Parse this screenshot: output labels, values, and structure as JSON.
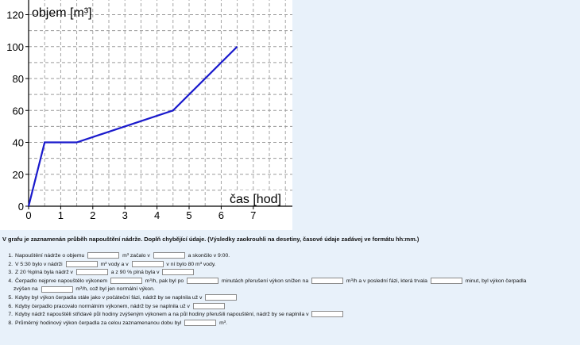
{
  "chart_data": {
    "type": "line",
    "xlabel": "čas [hod]",
    "ylabel": "objem [m³]",
    "x_ticks": [
      "0",
      "1",
      "2",
      "3",
      "4",
      "5",
      "6",
      "7"
    ],
    "y_ticks": [
      "0",
      "20",
      "40",
      "60",
      "80",
      "100",
      "120"
    ],
    "xlim": [
      0,
      8
    ],
    "ylim": [
      0,
      125
    ],
    "grid": true,
    "points": [
      [
        0,
        0
      ],
      [
        0.5,
        40
      ],
      [
        1.5,
        40
      ],
      [
        4.5,
        60
      ],
      [
        6.5,
        100
      ]
    ],
    "line_color": "#1a1acc"
  },
  "task": "V grafu je zaznamenán průběh napouštění nádrže. Doplň chybějící údaje. (Výsledky zaokrouhli na desetiny, časové údaje zadávej ve formátu hh:mm.)",
  "items": {
    "1": {
      "num": "1.",
      "a": "Napouštění nádrže o objemu",
      "b": "m³ začalo v",
      "c": "a skončilo v 9:00."
    },
    "2": {
      "num": "2.",
      "a": "V 5:30 bylo v nádrži",
      "b": "m³ vody a v",
      "c": "v ní bylo 80 m³ vody."
    },
    "3": {
      "num": "3.",
      "a": "Z 20 %plná byla nádrž v",
      "b": "a z 90 % plná byla v"
    },
    "4": {
      "num": "4.",
      "a": "Čerpadlo nejprve napouštělo výkonem",
      "b": "m³/h, pak byl po",
      "c": "minutách přerušení výkon snížen na",
      "d": "m³/h a v poslední fázi, která trvala",
      "e": "minut, byl výkon čerpadla",
      "f": "zvýšen na",
      "g": "m³/h, což byl jen normální výkon."
    },
    "5": {
      "num": "5.",
      "a": "Kdyby byl výkon čerpadla stále jako v počáteční fázi, nádrž by se naplnila už v"
    },
    "6": {
      "num": "6.",
      "a": "Kdyby čerpadlo pracovalo normálním výkonem, nádrž by se naplnila už v"
    },
    "7": {
      "num": "7.",
      "a": "Kdyby nádrž napouštěli střídavě půl hodiny zvýšeným výkonem a na půl hodiny přerušili napouštění, nádrž by se naplnila v"
    },
    "8": {
      "num": "8.",
      "a": "Průměrný hodinový výkon čerpadla za celou zaznamenanou dobu byl",
      "b": "m³."
    }
  }
}
